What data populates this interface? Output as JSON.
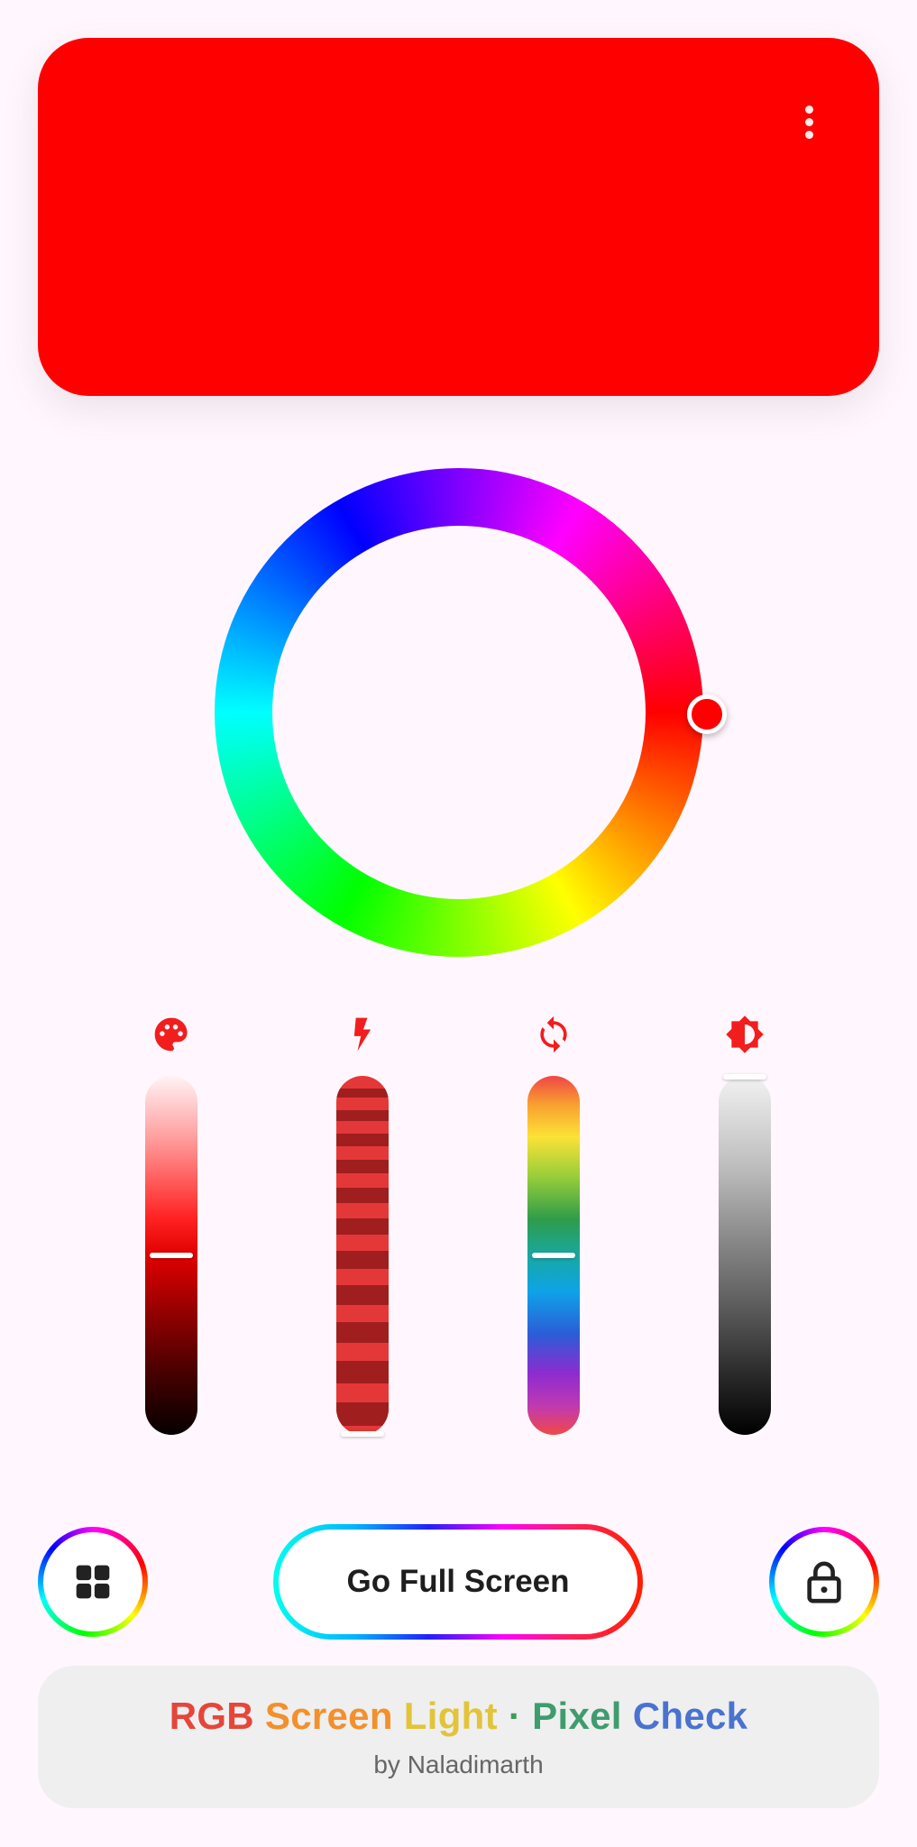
{
  "colors": {
    "current": "#FF0000",
    "icon_accent": "#F21D1D"
  },
  "preview": {
    "menu_icon": "more-vert-icon"
  },
  "wheel": {
    "hue_degrees": 0
  },
  "sliders": [
    {
      "id": "tint",
      "icon": "palette-icon",
      "level": 0.5
    },
    {
      "id": "strobe",
      "icon": "bolt-icon",
      "level": 0.0
    },
    {
      "id": "cycle",
      "icon": "refresh-icon",
      "level": 0.5
    },
    {
      "id": "brightness",
      "icon": "brightness-icon",
      "level": 1.0
    }
  ],
  "bottom": {
    "fullscreen_label": "Go Full Screen",
    "left_icon": "grid-icon",
    "right_icon": "lock-icon"
  },
  "footer": {
    "title_parts": [
      {
        "text": "RGB",
        "color": "#E5463A"
      },
      {
        "text": "Screen",
        "color": "#F3902C"
      },
      {
        "text": "Light",
        "color": "#E2C43A"
      },
      {
        "text": "·",
        "color": "#3E9C5A"
      },
      {
        "text": "Pixel",
        "color": "#3E9C6E"
      },
      {
        "text": "Check",
        "color": "#4A72CF"
      }
    ],
    "subtitle": "by Naladimarth"
  }
}
